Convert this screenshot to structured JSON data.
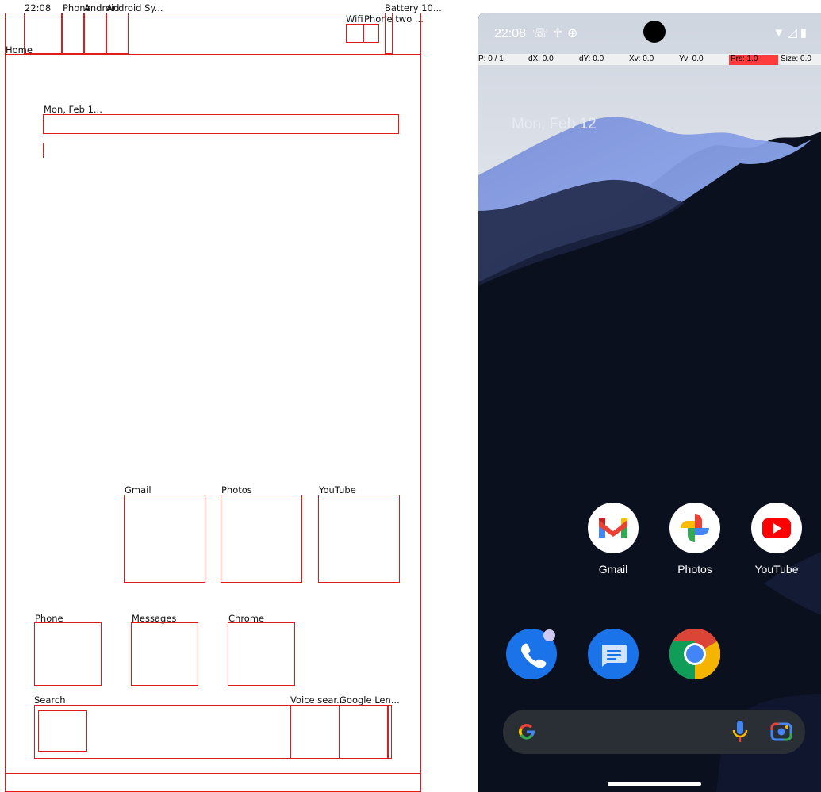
{
  "status_bar": {
    "time": "22:08",
    "left_icons": [
      "missed-call-icon",
      "accessibility-icon",
      "android-system-icon"
    ],
    "right_icons": [
      "wifi-icon",
      "signal-icon",
      "battery-icon"
    ]
  },
  "pointer_location": {
    "p": "P: 0 / 1",
    "dx": "dX: 0.0",
    "dy": "dY: 0.0",
    "xv": "Xv: 0.0",
    "yv": "Yv: 0.0",
    "prs": "Prs: 1.0",
    "size": "Size: 0.0",
    "prs_highlight": "#ff3b3b"
  },
  "home": {
    "date": "Mon, Feb 12",
    "apps_row": [
      {
        "name": "Gmail"
      },
      {
        "name": "Photos"
      },
      {
        "name": "YouTube"
      }
    ],
    "dock": [
      {
        "name": "Phone"
      },
      {
        "name": "Messages"
      },
      {
        "name": "Chrome"
      }
    ]
  },
  "search": {
    "label": "Search",
    "voice_label": "Voice search",
    "lens_label": "Google Lens"
  },
  "overlay": {
    "time": "22:08",
    "phone_short": "Phone",
    "android1": "Android",
    "android2": "Android Sy...",
    "battery": "Battery 10...",
    "wifi": "Wifi",
    "phone_two": "Phone two ...",
    "home": "Home",
    "date": "Mon, Feb 1...",
    "gmail": "Gmail",
    "photos": "Photos",
    "youtube": "YouTube",
    "phone": "Phone",
    "messages": "Messages",
    "chrome": "Chrome",
    "search": "Search",
    "voice": "Voice sear...",
    "lens": "Google Len..."
  },
  "colors": {
    "overlay_border": "#e01b1b",
    "phone_bg": "#0a0f1d",
    "search_bg": "#2a2e35",
    "phone_app": "#1a73e8",
    "messages_app": "#1a73e8",
    "youtube_red": "#ff0000"
  }
}
